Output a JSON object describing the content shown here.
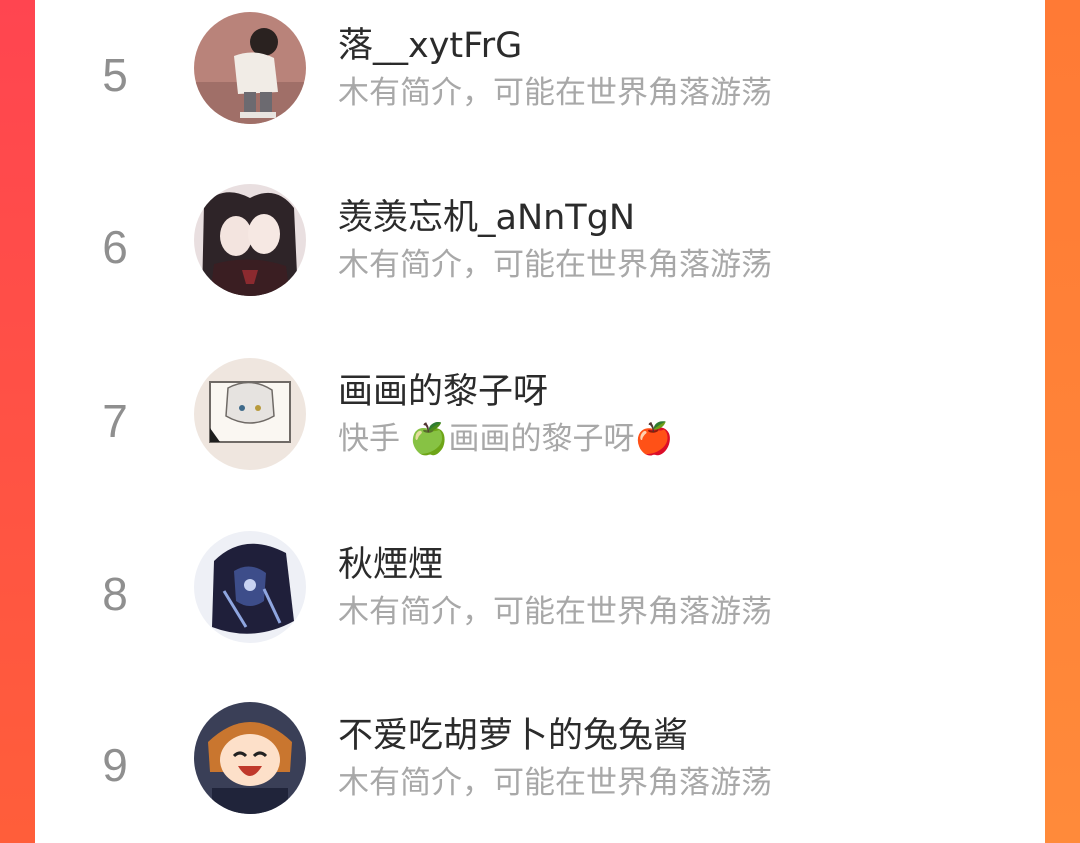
{
  "ranking": {
    "rows": [
      {
        "rank": "5",
        "name": "落__xytFrG",
        "bio": "木有简介，可能在世界角落游荡",
        "avatar_icon": "avatar-child-white-hoodie"
      },
      {
        "rank": "6",
        "name": "羡羡忘机_aNnTgN",
        "bio": "木有简介，可能在世界角落游荡",
        "avatar_icon": "avatar-anime-couple"
      },
      {
        "rank": "7",
        "name": "画画的黎子呀",
        "bio": "快手 🍏画画的黎子呀🍎",
        "avatar_icon": "avatar-anime-sketch"
      },
      {
        "rank": "8",
        "name": "秋煙煙",
        "bio": "木有简介，可能在世界角落游荡",
        "avatar_icon": "avatar-dark-anime"
      },
      {
        "rank": "9",
        "name": "不爱吃胡萝卜的兔兔酱",
        "bio": "木有简介，可能在世界角落游荡",
        "avatar_icon": "avatar-laughing-girl"
      }
    ]
  },
  "colors": {
    "accent_left": "#ff4550",
    "accent_right": "#ff8a3a",
    "name_text": "#2b2b2b",
    "bio_text": "#a8a8a8",
    "rank_text": "#8f8f8f"
  }
}
